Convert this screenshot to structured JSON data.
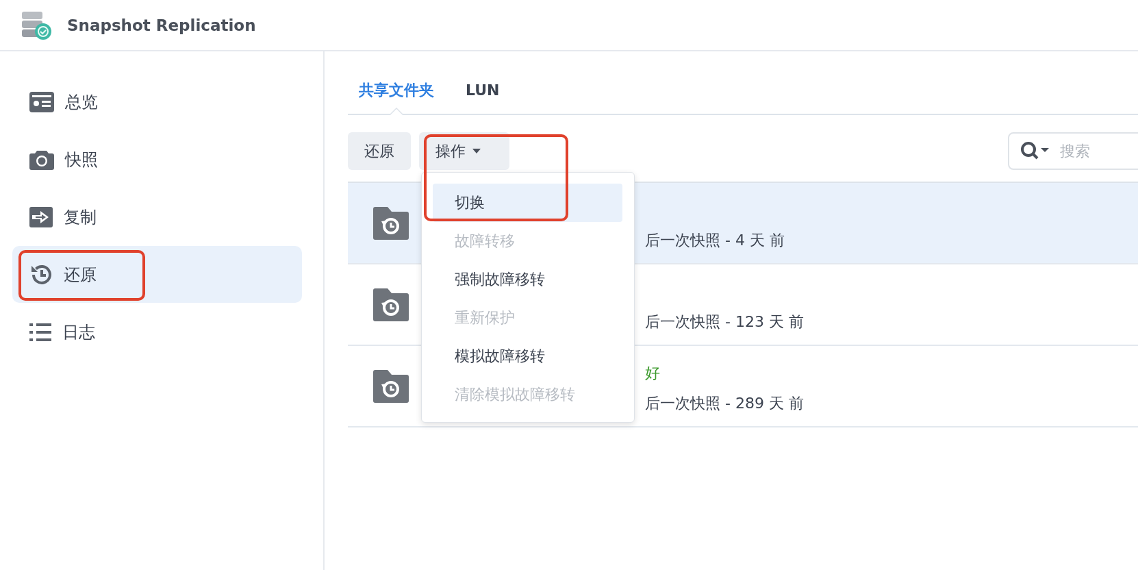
{
  "header": {
    "title": "Snapshot Replication"
  },
  "sidebar": {
    "items": [
      {
        "kind": "overview",
        "label": "总览",
        "selected": false,
        "callout": false
      },
      {
        "kind": "snapshot",
        "label": "快照",
        "selected": false,
        "callout": false
      },
      {
        "kind": "replication",
        "label": "复制",
        "selected": false,
        "callout": false
      },
      {
        "kind": "restore",
        "label": "还原",
        "selected": true,
        "callout": true
      },
      {
        "kind": "log",
        "label": "日志",
        "selected": false,
        "callout": false
      }
    ]
  },
  "tabs": [
    {
      "label": "共享文件夹",
      "selected": true
    },
    {
      "label": "LUN",
      "selected": false
    }
  ],
  "toolbar": {
    "buttons": [
      {
        "label": "还原"
      }
    ],
    "actions_menu": {
      "label": "操作",
      "open": true,
      "callout": true,
      "items": [
        {
          "label": "切换",
          "disabled": false,
          "selected": true
        },
        {
          "label": "故障转移",
          "disabled": true,
          "selected": false
        },
        {
          "label": "强制故障移转",
          "disabled": false,
          "selected": false
        },
        {
          "label": "重新保护",
          "disabled": true,
          "selected": false
        },
        {
          "label": "模拟故障移转",
          "disabled": false,
          "selected": false
        },
        {
          "label": "清除模拟故障移转",
          "disabled": true,
          "selected": false
        }
      ]
    },
    "search": {
      "placeholder": "搜索"
    }
  },
  "rows": [
    {
      "selected": true,
      "last_snapshot": "后一次快照 - 4 天 前"
    },
    {
      "selected": false,
      "last_snapshot": "后一次快照 - 123 天 前"
    },
    {
      "selected": false,
      "status": "好",
      "last_snapshot": "后一次快照 - 289 天 前"
    }
  ]
}
